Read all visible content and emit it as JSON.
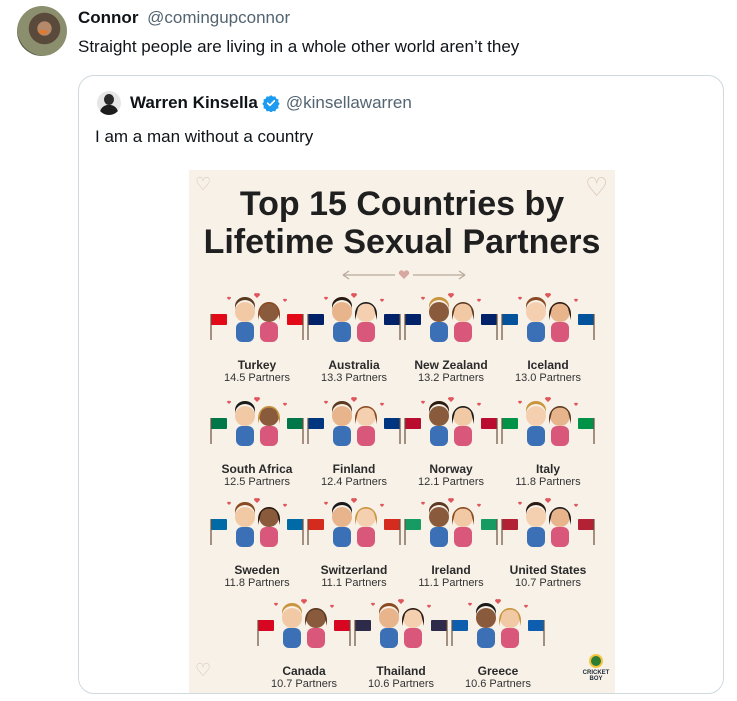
{
  "tweet": {
    "author_name": "Connor",
    "author_handle": "@comingupconnor",
    "text": "Straight people are living in a whole other world aren’t they"
  },
  "quote": {
    "author_name": "Warren Kinsella",
    "author_handle": "@kinsellawarren",
    "text": "I am a man without a country",
    "verified": true
  },
  "infographic": {
    "title_line1": "Top 15 Countries by",
    "title_line2": "Lifetime Sexual Partners",
    "logo_text": "CRICKET BOY",
    "countries": [
      {
        "name": "Turkey",
        "value": "14.5 Partners",
        "flag": "#e30a17"
      },
      {
        "name": "Australia",
        "value": "13.3 Partners",
        "flag": "#012169"
      },
      {
        "name": "New Zealand",
        "value": "13.2 Partners",
        "flag": "#012169"
      },
      {
        "name": "Iceland",
        "value": "13.0 Partners",
        "flag": "#02529c"
      },
      {
        "name": "South Africa",
        "value": "12.5 Partners",
        "flag": "#007749"
      },
      {
        "name": "Finland",
        "value": "12.4 Partners",
        "flag": "#003580"
      },
      {
        "name": "Norway",
        "value": "12.1 Partners",
        "flag": "#ba0c2f"
      },
      {
        "name": "Italy",
        "value": "11.8 Partners",
        "flag": "#009246"
      },
      {
        "name": "Sweden",
        "value": "11.8 Partners",
        "flag": "#006aa7"
      },
      {
        "name": "Switzerland",
        "value": "11.1 Partners",
        "flag": "#d52b1e"
      },
      {
        "name": "Ireland",
        "value": "11.1 Partners",
        "flag": "#169b62"
      },
      {
        "name": "United States",
        "value": "10.7 Partners",
        "flag": "#b22234"
      },
      {
        "name": "Canada",
        "value": "10.7 Partners",
        "flag": "#d80621"
      },
      {
        "name": "Thailand",
        "value": "10.6 Partners",
        "flag": "#2d2a4a"
      },
      {
        "name": "Greece",
        "value": "10.6 Partners",
        "flag": "#0d5eaf"
      }
    ]
  }
}
